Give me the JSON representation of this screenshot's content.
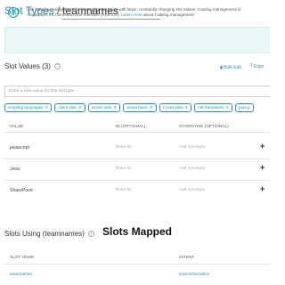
{
  "header": {
    "breadcrumb": "Slot Types",
    "separator": "/",
    "slot_type_name": "teamnames"
  },
  "info_banner": {
    "icon": "info-icon",
    "line1": "Use Catalog management for managing slot types with large, constantly changing slot values. Catalog management is",
    "line2_prefix": "Alexa Skills Kit Command Line Interface (ASK CLI).",
    "line2_link": "Learn more",
    "line2_suffix": "about Catalog management."
  },
  "slot_values": {
    "title": "Slot Values (3)",
    "bulk_edit": "Bulk Edit",
    "export": "Expo",
    "new_value_placeholder": "Enter a new value for this slot type",
    "chips": [
      "scripting languages",
      "client side",
      "server side",
      "visual basic",
      "C plus plus",
      "net framework",
      "java p"
    ],
    "columns": {
      "value": "VALUE",
      "id": "ID (OPTIONAL)",
      "synonyms": "SYNONYMS (OPTIONAL)"
    },
    "id_placeholder": "Enter ID",
    "synonym_placeholder": "Add synonym",
    "add_symbol": "+",
    "rows": [
      {
        "value": "javascript"
      },
      {
        "value": "Java"
      },
      {
        "value": "SharePoint"
      }
    ]
  },
  "slots_using": {
    "title": "Slots Using (teamnames)",
    "annotation": "Slots Mapped",
    "columns": {
      "slot_name": "SLOT NAME",
      "intent": "INTENT"
    },
    "rows": [
      {
        "slot_name": "teamnames",
        "intent": "teaminformation"
      }
    ]
  },
  "colors": {
    "link": "#2e8bbd",
    "info_bg": "#eaf7f8",
    "info_icon": "#12a9b8"
  }
}
